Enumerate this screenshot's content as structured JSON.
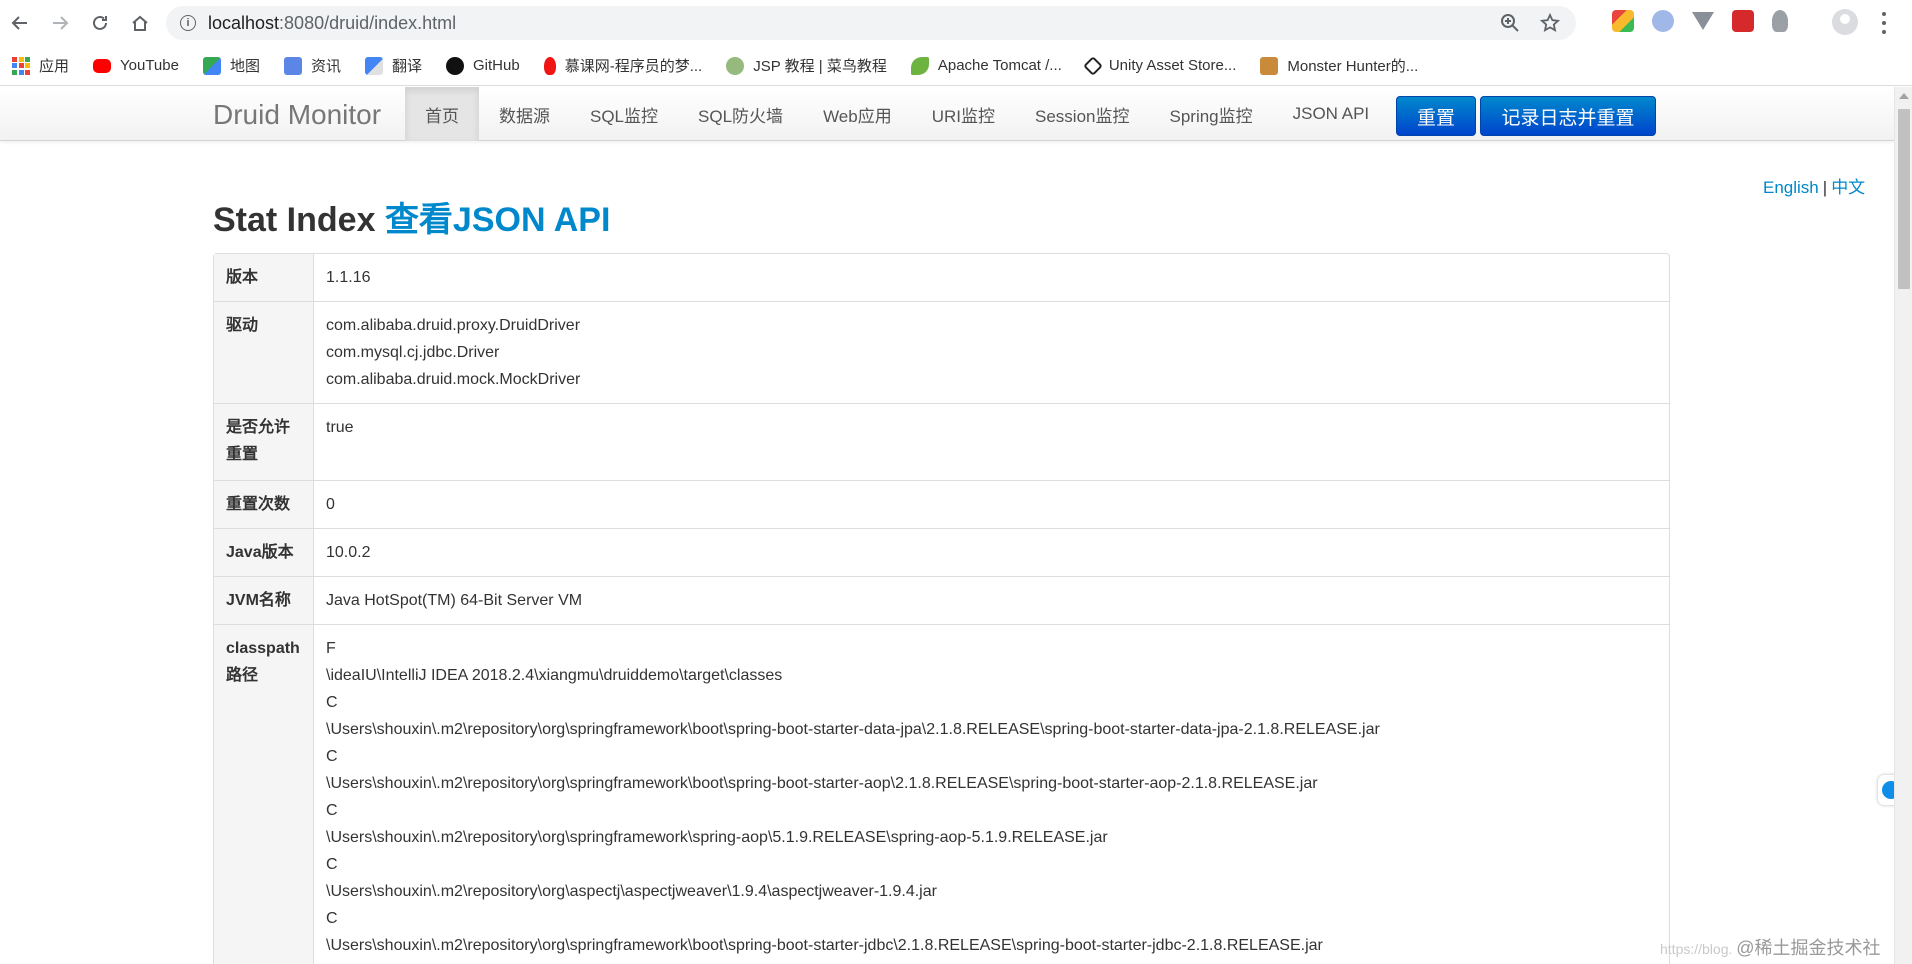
{
  "browser": {
    "url_host": "localhost",
    "url_path": ":8080/druid/index.html",
    "bookmarks": [
      {
        "label": "应用",
        "icon": "apps-grid-icon"
      },
      {
        "label": "YouTube",
        "icon": "youtube-icon"
      },
      {
        "label": "地图",
        "icon": "maps-icon"
      },
      {
        "label": "资讯",
        "icon": "news-icon"
      },
      {
        "label": "翻译",
        "icon": "translate-icon"
      },
      {
        "label": "GitHub",
        "icon": "github-icon"
      },
      {
        "label": "慕课网-程序员的梦...",
        "icon": "imooc-icon"
      },
      {
        "label": "JSP 教程 | 菜鸟教程",
        "icon": "runoob-icon"
      },
      {
        "label": "Apache Tomcat /...",
        "icon": "tomcat-icon"
      },
      {
        "label": "Unity Asset Store...",
        "icon": "unity-icon"
      },
      {
        "label": "Monster Hunter的...",
        "icon": "monster-hunter-icon"
      }
    ]
  },
  "navbar": {
    "brand": "Druid Monitor",
    "items": [
      "首页",
      "数据源",
      "SQL监控",
      "SQL防火墙",
      "Web应用",
      "URI监控",
      "Session监控",
      "Spring监控",
      "JSON API"
    ],
    "reset_label": "重置",
    "log_reset_label": "记录日志并重置"
  },
  "lang": {
    "english": "English",
    "separator": "|",
    "chinese": "中文"
  },
  "title": {
    "prefix": "Stat Index",
    "link": "查看JSON API"
  },
  "stats": {
    "version": {
      "key": "版本",
      "value": "1.1.16"
    },
    "drivers": {
      "key": "驱动",
      "values": [
        "com.alibaba.druid.proxy.DruidDriver",
        "com.mysql.cj.jdbc.Driver",
        "com.alibaba.druid.mock.MockDriver"
      ]
    },
    "reset_enable": {
      "key": "是否允许重置",
      "value": "true"
    },
    "reset_count": {
      "key": "重置次数",
      "value": "0"
    },
    "java_version": {
      "key": "Java版本",
      "value": "10.0.2"
    },
    "jvm_name": {
      "key": "JVM名称",
      "value": "Java HotSpot(TM) 64-Bit Server VM"
    },
    "classpath": {
      "key": "classpath路径",
      "values": [
        "F",
        "\\ideaIU\\IntelliJ IDEA 2018.2.4\\xiangmu\\druiddemo\\target\\classes",
        "C",
        "\\Users\\shouxin\\.m2\\repository\\org\\springframework\\boot\\spring-boot-starter-data-jpa\\2.1.8.RELEASE\\spring-boot-starter-data-jpa-2.1.8.RELEASE.jar",
        "C",
        "\\Users\\shouxin\\.m2\\repository\\org\\springframework\\boot\\spring-boot-starter-aop\\2.1.8.RELEASE\\spring-boot-starter-aop-2.1.8.RELEASE.jar",
        "C",
        "\\Users\\shouxin\\.m2\\repository\\org\\springframework\\spring-aop\\5.1.9.RELEASE\\spring-aop-5.1.9.RELEASE.jar",
        "C",
        "\\Users\\shouxin\\.m2\\repository\\org\\aspectj\\aspectjweaver\\1.9.4\\aspectjweaver-1.9.4.jar",
        "C",
        "\\Users\\shouxin\\.m2\\repository\\org\\springframework\\boot\\spring-boot-starter-jdbc\\2.1.8.RELEASE\\spring-boot-starter-jdbc-2.1.8.RELEASE.jar"
      ]
    }
  },
  "watermark": {
    "faint": "https://blog.",
    "strong": "@稀土掘金技术社区"
  },
  "colors": {
    "link": "#0088cc",
    "primary_button": "#0055cc"
  }
}
